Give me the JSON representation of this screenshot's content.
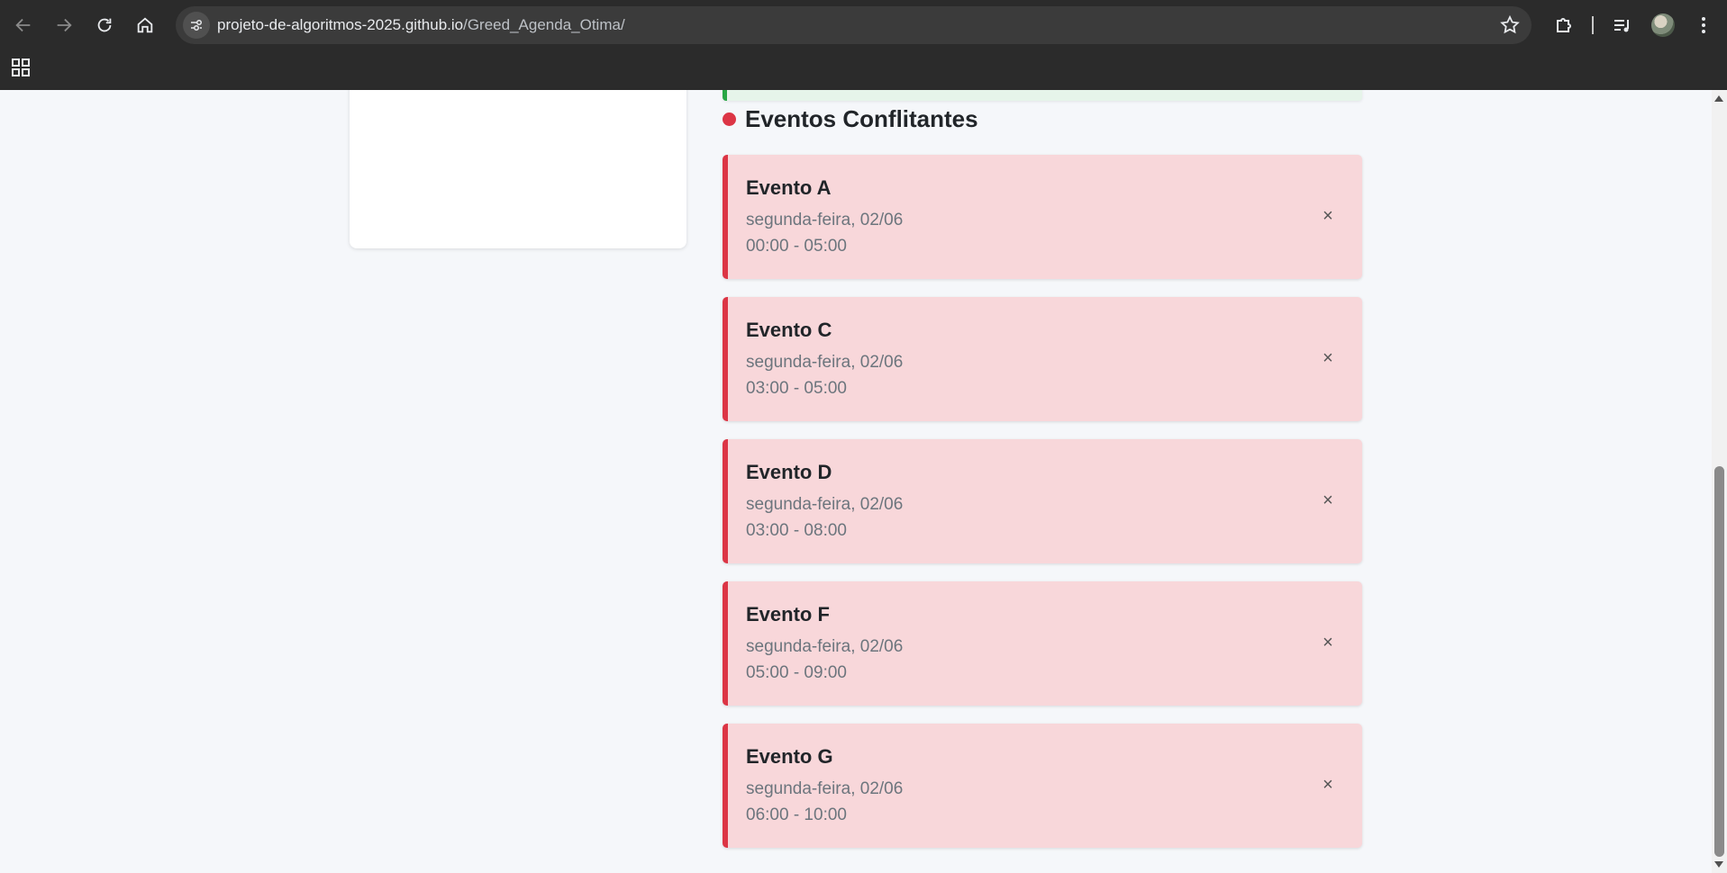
{
  "browser": {
    "url_host": "projeto-de-algoritmos-2025.github.io",
    "url_path": "/Greed_Agenda_Otima/"
  },
  "section": {
    "title": "Eventos Conflitantes",
    "accent_color": "#dc3545"
  },
  "events": [
    {
      "title": "Evento A",
      "date": "segunda-feira, 02/06",
      "time": "00:00 - 05:00",
      "remove": "×"
    },
    {
      "title": "Evento C",
      "date": "segunda-feira, 02/06",
      "time": "03:00 - 05:00",
      "remove": "×"
    },
    {
      "title": "Evento D",
      "date": "segunda-feira, 02/06",
      "time": "03:00 - 08:00",
      "remove": "×"
    },
    {
      "title": "Evento F",
      "date": "segunda-feira, 02/06",
      "time": "05:00 - 09:00",
      "remove": "×"
    },
    {
      "title": "Evento G",
      "date": "segunda-feira, 02/06",
      "time": "06:00 - 10:00",
      "remove": "×"
    }
  ],
  "colors": {
    "conflict_bg": "#f8d7da",
    "conflict_border": "#dc3545",
    "ok_border": "#28a745"
  }
}
